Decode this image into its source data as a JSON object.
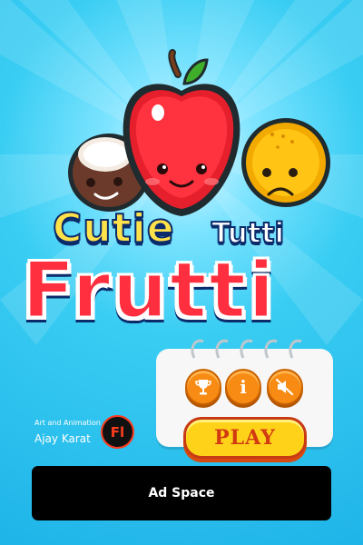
{
  "game": {
    "title_line1": "Cutie",
    "title_line1b": "Tutti",
    "title_line2": "Frutti"
  },
  "menu": {
    "play_label": "PLAY",
    "buttons": [
      {
        "icon": "trophy-icon"
      },
      {
        "icon": "info-icon",
        "glyph": "i"
      },
      {
        "icon": "sound-muted-icon"
      }
    ]
  },
  "credits": {
    "role": "Art and Animation",
    "name": "Ajay Karat",
    "tool_badge": "Fl"
  },
  "ad": {
    "label": "Ad Space"
  },
  "colors": {
    "background": "#2cc4f0",
    "accent_red": "#ff2f3f",
    "accent_yellow": "#ffd21a",
    "button_orange": "#f78b14",
    "outline_navy": "#0b2b6b"
  }
}
